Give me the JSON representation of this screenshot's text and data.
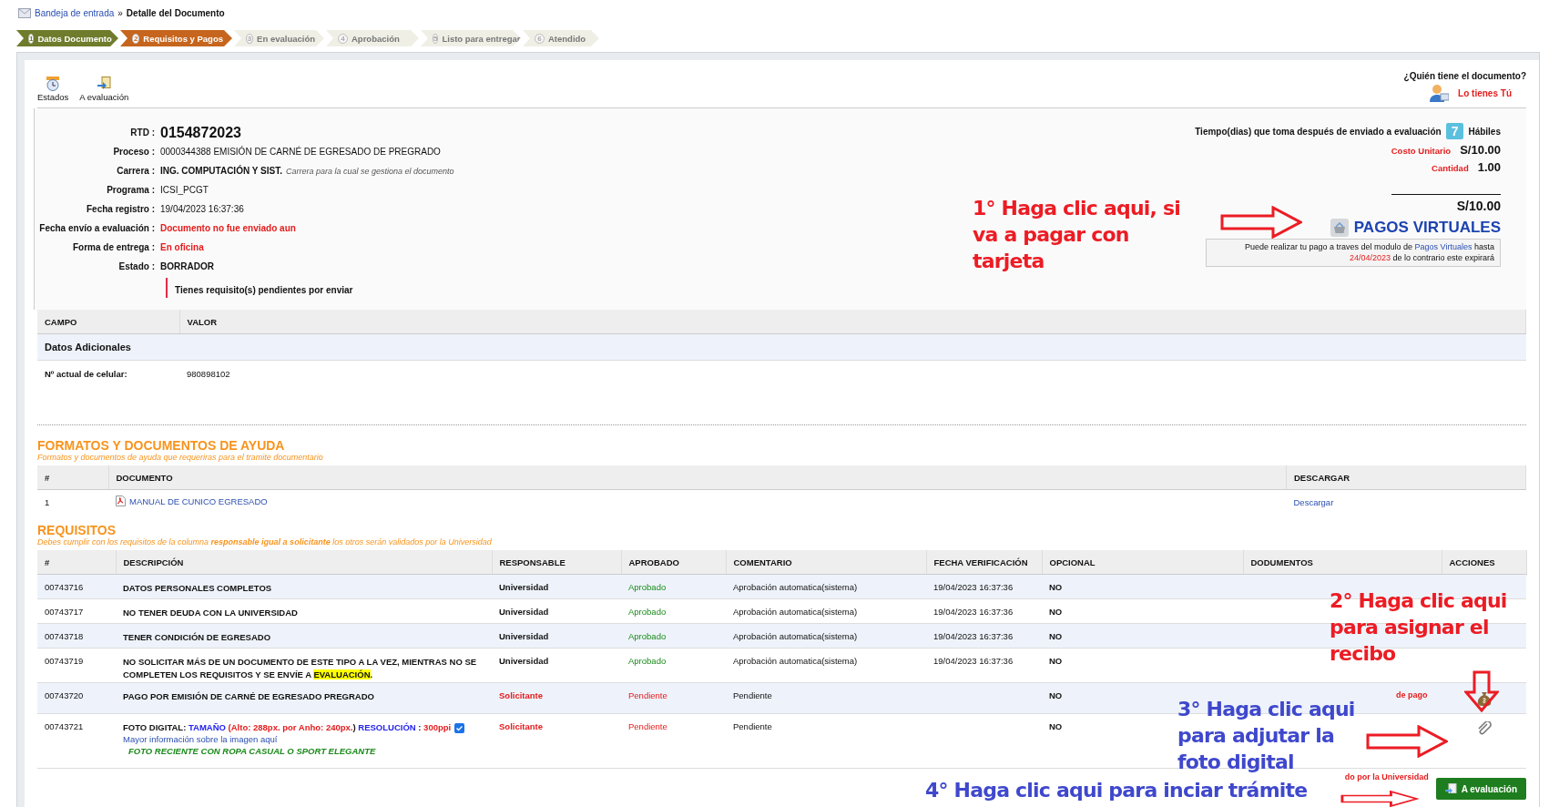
{
  "breadcrumb": {
    "link": "Bandeja de entrada",
    "separator": "»",
    "current": "Detalle del Documento"
  },
  "steps": [
    {
      "number": "1",
      "label": "Datos Documento",
      "kind": "done"
    },
    {
      "number": "2",
      "label": "Requisitos y Pagos",
      "kind": "current"
    },
    {
      "number": "3",
      "label": "En evaluación",
      "kind": "pending"
    },
    {
      "number": "4",
      "label": "Aprobación",
      "kind": "pending"
    },
    {
      "number": "5",
      "label": "Listo para entregar",
      "kind": "pending"
    },
    {
      "number": "6",
      "label": "Atendido",
      "kind": "pending"
    }
  ],
  "toolbar": [
    {
      "label": "Estados"
    },
    {
      "label": "A evaluación"
    }
  ],
  "owner": {
    "question": "¿Quién tiene el documento?",
    "value": "Lo tienes Tú"
  },
  "document": {
    "fields": [
      {
        "label": "RTD :",
        "value": "0154872023",
        "kind": "large"
      },
      {
        "label": "Proceso :",
        "value": "0000344388 EMISIÓN DE CARNÉ DE EGRESADO DE PREGRADO",
        "kind": "plain"
      },
      {
        "label": "Carrera :",
        "value": "ING. COMPUTACIÓN Y SIST.",
        "note": "Carrera para la cual se gestiona el documento",
        "kind": "bold"
      },
      {
        "label": "Programa :",
        "value": "ICSI_PCGT",
        "kind": "plain"
      },
      {
        "label": "Fecha registro :",
        "value": "19/04/2023 16:37:36",
        "kind": "plain"
      },
      {
        "label": "Fecha envío a evaluación :",
        "value": "Documento no fue enviado aun",
        "kind": "alert"
      },
      {
        "label": "Forma de entrega :",
        "value": "En oficina",
        "kind": "alert"
      },
      {
        "label": "Estado :",
        "value": "BORRADOR",
        "kind": "bold"
      }
    ],
    "warning": "Tienes requisito(s) pendientes por enviar"
  },
  "costs": {
    "time_label": "Tiempo(dias) que toma después de enviado a evaluación",
    "days": "7",
    "days_unit": "Hábiles",
    "unit_cost_label": "Costo Unitario",
    "unit_cost": "S/10.00",
    "quantity_label": "Cantidad",
    "quantity": "1.00",
    "total": "S/10.00",
    "virtual_payments": "PAGOS VIRTUALES",
    "payment_note": {
      "before": "Puede realizar tu pago a traves del modulo de ",
      "link": "Pagos Virtuales",
      "after": " hasta",
      "date": "24/04/2023",
      "end": " de lo contrario este expirará"
    }
  },
  "additional": {
    "columns": [
      "CAMPO",
      "VALOR"
    ],
    "group": "Datos Adicionales",
    "rows": [
      {
        "field": "Nº actual de celular:",
        "value": "980898102"
      }
    ]
  },
  "formats": {
    "title": "FORMATOS Y DOCUMENTOS DE AYUDA",
    "subtitle": "Formatos y documentos de ayuda que requeriras para el tramite documentario",
    "columns": [
      "#",
      "DOCUMENTO",
      "DESCARGAR"
    ],
    "rows": [
      {
        "number": "1",
        "document": "MANUAL DE CUNICO EGRESADO",
        "download": "Descargar"
      }
    ]
  },
  "requirements": {
    "title": "REQUISITOS",
    "subtitle": "Debes cumplir con los requisitos de la columna **responsable igual a solicitante** los otros serán validados por la Universidad",
    "columns": [
      "#",
      "DESCRIPCIÓN",
      "RESPONSABLE",
      "APROBADO",
      "COMENTARIO",
      "FECHA VERIFICACIÓN",
      "OPCIONAL",
      "DODUMENTOS",
      "ACCIONES"
    ],
    "rows": [
      {
        "code": "00743716",
        "description": [
          {
            "text": "DATOS PERSONALES COMPLETOS",
            "kind": "plain"
          }
        ],
        "responsible": "Universidad",
        "approval": "Aprobado",
        "kind": "approved",
        "comment": "Aprobación automatica(sistema)",
        "date": "19/04/2023 16:37:36",
        "optional": "NO"
      },
      {
        "code": "00743717",
        "description": [
          {
            "text": "NO TENER DEUDA CON LA UNIVERSIDAD",
            "kind": "plain"
          }
        ],
        "responsible": "Universidad",
        "approval": "Aprobado",
        "kind": "approved",
        "comment": "Aprobación automatica(sistema)",
        "date": "19/04/2023 16:37:36",
        "optional": "NO"
      },
      {
        "code": "00743718",
        "description": [
          {
            "text": "TENER CONDICIÓN DE EGRESADO",
            "kind": "plain"
          }
        ],
        "responsible": "Universidad",
        "approval": "Aprobado",
        "kind": "approved",
        "comment": "Aprobación automatica(sistema)",
        "date": "19/04/2023 16:37:36",
        "optional": "NO"
      },
      {
        "code": "00743719",
        "description": [
          {
            "text": "NO SOLICITAR MÁS DE UN DOCUMENTO DE ESTE TIPO A LA VEZ,  MIENTRAS NO SE COMPLETEN LOS REQUISITOS Y SE ENVÍE A ",
            "kind": "plain"
          },
          {
            "text": "EVALUACIÓN",
            "kind": "highlight"
          },
          {
            "text": ".",
            "kind": "plain"
          }
        ],
        "responsible": "Universidad",
        "approval": "Aprobado",
        "kind": "approved",
        "comment": "Aprobación automatica(sistema)",
        "date": "19/04/2023 16:37:36",
        "optional": "NO"
      },
      {
        "code": "00743720",
        "description": [
          {
            "text": "PAGO POR EMISIÓN DE CARNÉ DE EGRESADO PREGRADO",
            "kind": "plain"
          }
        ],
        "responsible": "Solicitante",
        "approval": "Pendiente",
        "kind": "pending",
        "comment": "Pendiente",
        "optional": "NO",
        "document_text": "de pago",
        "action": {
          "kind": "money-bag"
        }
      },
      {
        "code": "00743721",
        "description": [
          {
            "text": "FOTO DIGITAL: ",
            "kind": "plain"
          },
          {
            "text": "TAMAÑO",
            "kind": "blue"
          },
          {
            "text": " (",
            "kind": "red"
          },
          {
            "text": "Alto: 288px. por Anho: 240px.",
            "kind": "red"
          },
          {
            "text": ")",
            "kind": "plain"
          },
          {
            "text": " RESOLUCIÓN",
            "kind": "blue"
          },
          {
            "text": " : ",
            "kind": "plain"
          },
          {
            "text": "300ppi",
            "kind": "red"
          }
        ],
        "checked": true,
        "info_link": "Mayor información sobre la imagen aquí",
        "note": "FOTO RECIENTE CON ROPA CASUAL O SPORT ELEGANTE",
        "responsible": "Solicitante",
        "approval": "Pendiente",
        "kind": "pending",
        "comment": "Pendiente",
        "optional": "NO",
        "action": {
          "kind": "attach"
        }
      }
    ]
  },
  "footer": {
    "note": "do por la Universidad",
    "button": "A evaluación"
  },
  "annotations": [
    {
      "text": "1° Haga clic aqui, si va a pagar con tarjeta",
      "color": "#ec1c24",
      "kind": "right"
    },
    {
      "text": "2° Haga clic aqui para asignar el recibo",
      "color": "#ec1c24",
      "kind": "down"
    },
    {
      "text": "3° Haga clic aqui para adjutar la foto digital",
      "color": "#3f48cc",
      "kind": "right"
    },
    {
      "text": "4° Haga clic aqui para inciar trámite",
      "color": "#3f48cc",
      "kind": "right"
    }
  ]
}
